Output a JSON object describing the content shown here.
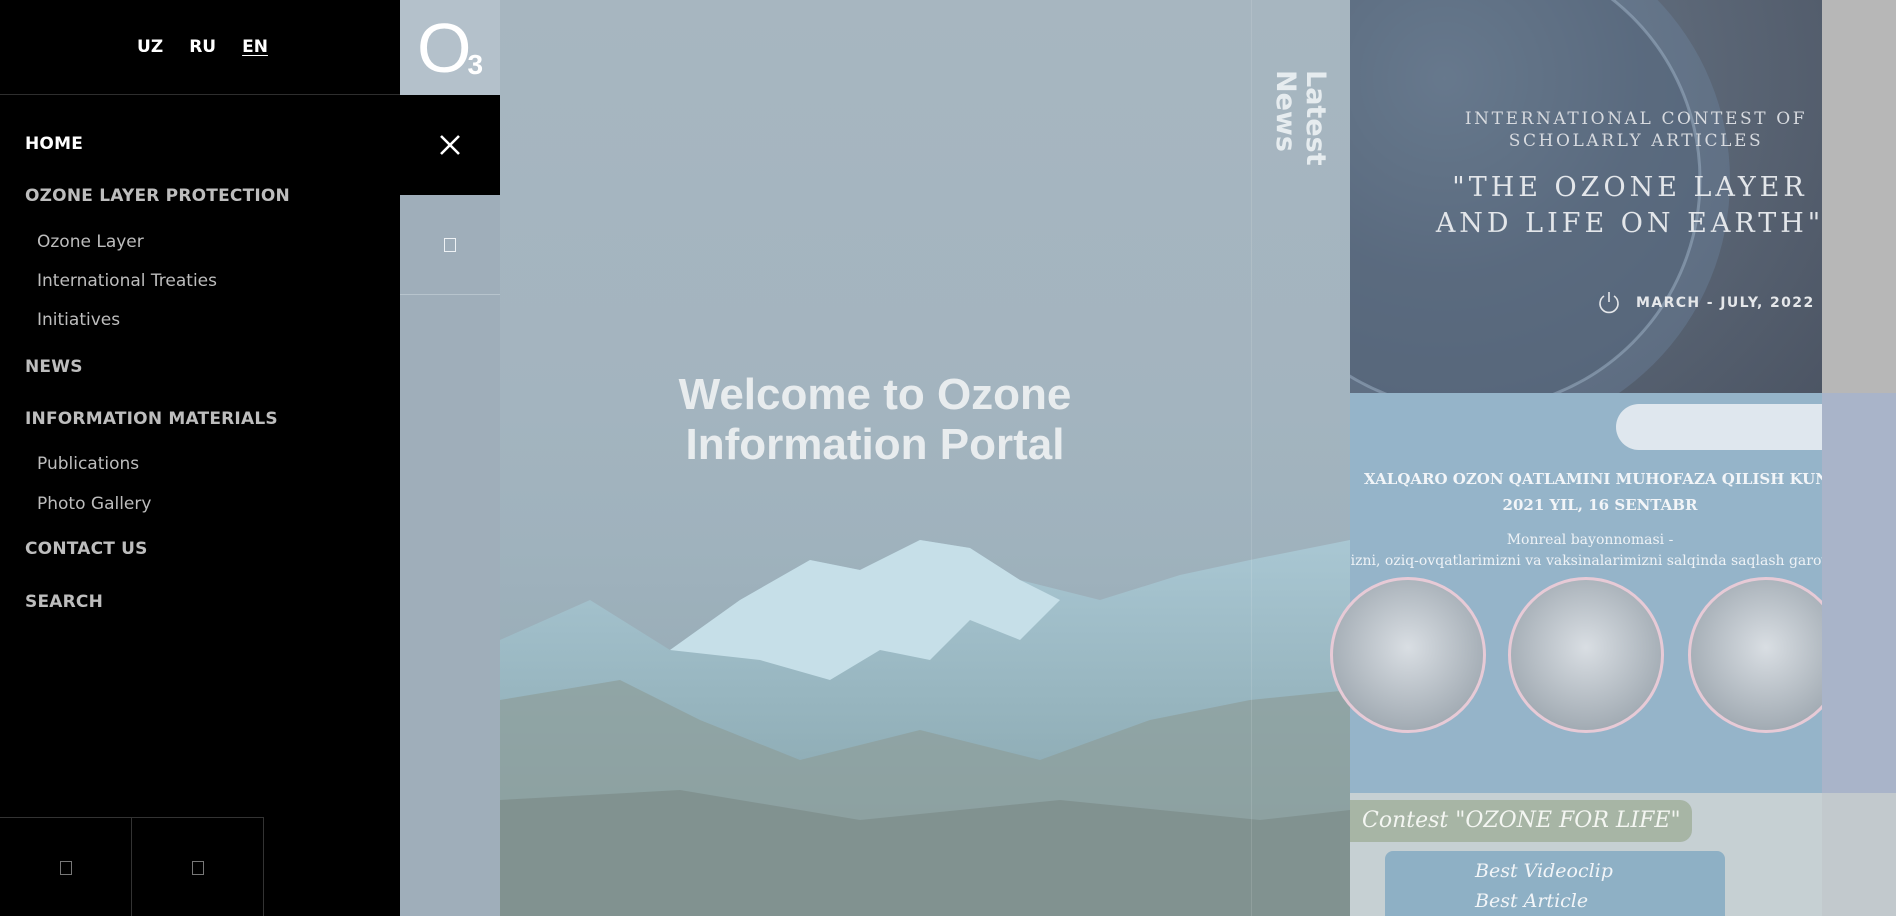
{
  "languages": [
    {
      "code": "UZ",
      "active": false
    },
    {
      "code": "RU",
      "active": false
    },
    {
      "code": "EN",
      "active": true
    }
  ],
  "nav": {
    "home": "HOME",
    "ozone_protection": "OZONE LAYER PROTECTION",
    "ozone_layer": "Ozone Layer",
    "treaties": "International Treaties",
    "initiatives": "Initiatives",
    "news": "NEWS",
    "info_materials": "INFORMATION MATERIALS",
    "publications": "Publications",
    "photo_gallery": "Photo Gallery",
    "contact": "CONTACT US",
    "search": "SEARCH"
  },
  "logo": {
    "letter": "O",
    "subscript": "3"
  },
  "hero": {
    "title_line1": "Welcome to Ozone",
    "title_line2": "Information Portal"
  },
  "latest_news_label_1": "Latest",
  "latest_news_label_2": "News",
  "cards": {
    "card1": {
      "subtitle_line1": "INTERNATIONAL CONTEST OF",
      "subtitle_line2": "SCHOLARLY ARTICLES",
      "title_line1": "\"THE OZONE LAYER",
      "title_line2": "AND LIFE ON EARTH\"",
      "date": "MARCH - JULY, 2022"
    },
    "card2": {
      "title_line1": "XALQARO OZON QATLAMINI MUHOFAZA QILISH KUNI",
      "title_line2": "2021 YIL, 16 SENTABR",
      "text_line1": "Monreal bayonnomasi -",
      "text_line2": "izni, oziq-ovqatlarimizni va vaksinalarimizni salqinda saqlash garov"
    },
    "card3": {
      "banner": "Contest \"OZONE FOR LIFE\"",
      "item1": "Best Videoclip",
      "item2": "Best Article"
    }
  },
  "icons": {
    "close": "close-icon",
    "search": "search-icon",
    "social_1": "social-icon",
    "social_2": "social-icon",
    "power": "power-icon"
  }
}
